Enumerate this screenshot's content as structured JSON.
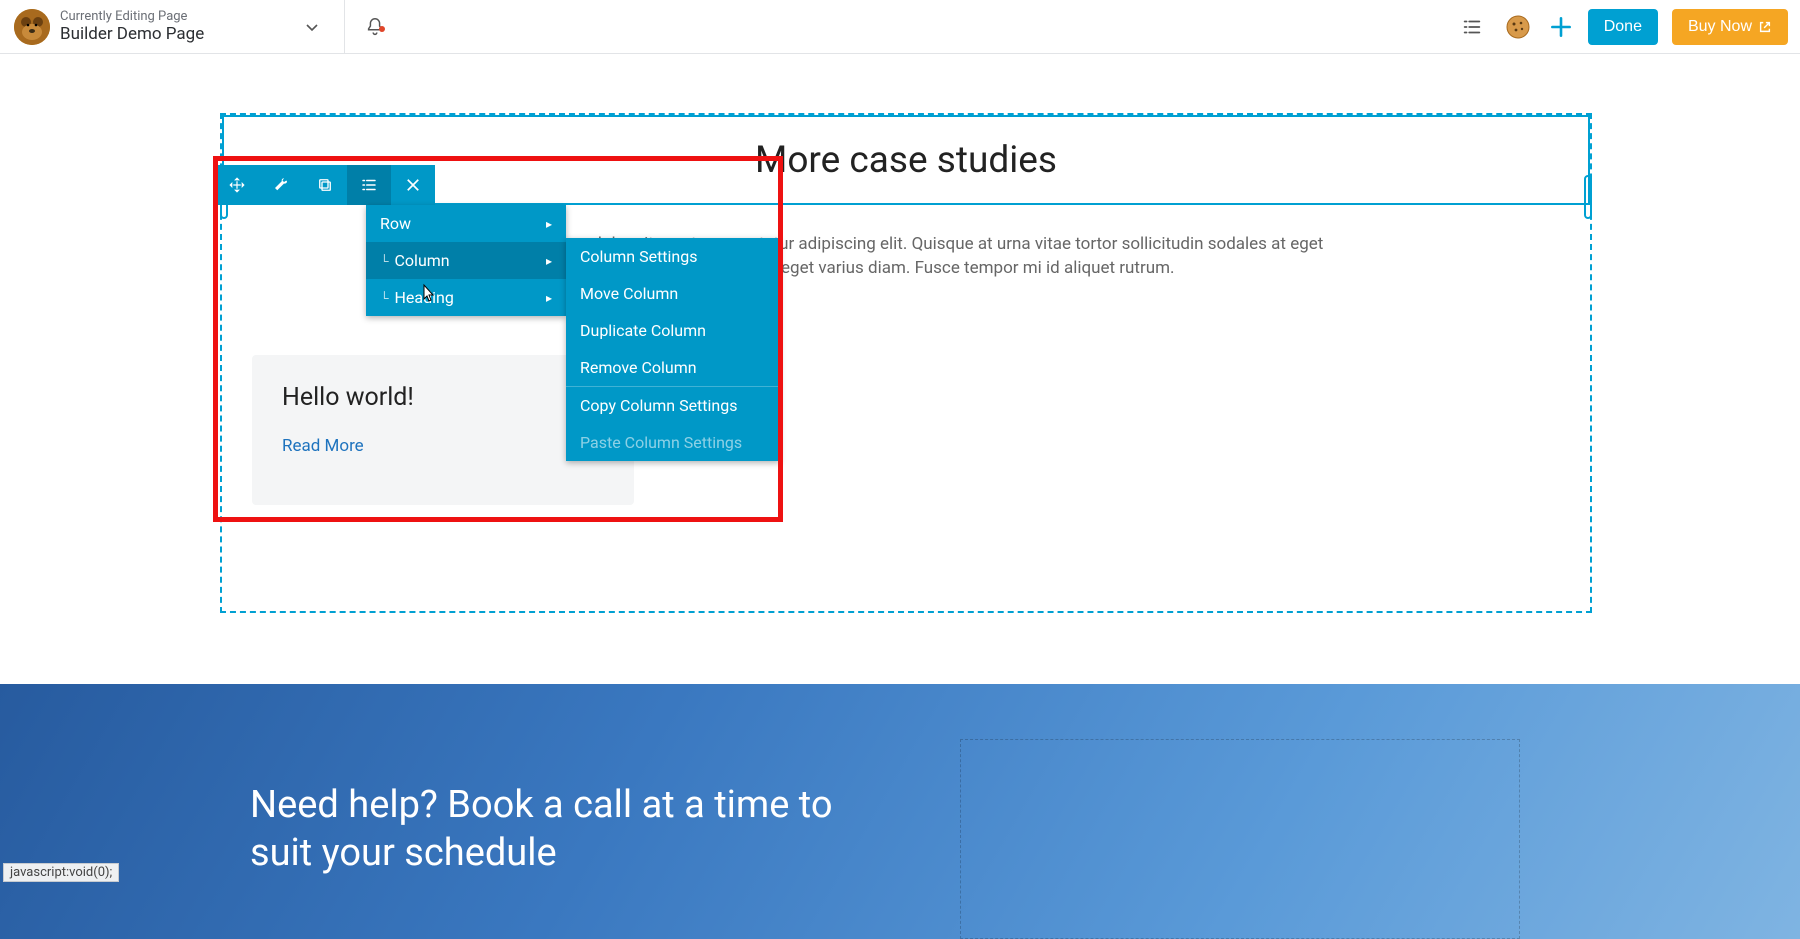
{
  "header": {
    "subtitle": "Currently Editing Page",
    "title": "Builder Demo Page",
    "done": "Done",
    "buy": "Buy Now"
  },
  "content": {
    "heading": "More case studies",
    "lorem": "Lorem ipsum dolor sit amet, consectetur adipiscing elit. Quisque at urna vitae tortor sollicitudin sodales at eget mauris. Maecenas eget varius diam. Fusce tempor mi id aliquet rutrum.",
    "card_title": "Hello world!",
    "card_link": "Read More"
  },
  "menu1": {
    "row": "Row",
    "column": "Column",
    "heading": "Heading"
  },
  "menu2": {
    "settings": "Column Settings",
    "move": "Move Column",
    "duplicate": "Duplicate Column",
    "remove": "Remove Column",
    "copy": "Copy Column Settings",
    "paste": "Paste Column Settings"
  },
  "hero": {
    "title": "Need help? Book a call at a time to suit your schedule"
  },
  "status": "javascript:void(0);"
}
